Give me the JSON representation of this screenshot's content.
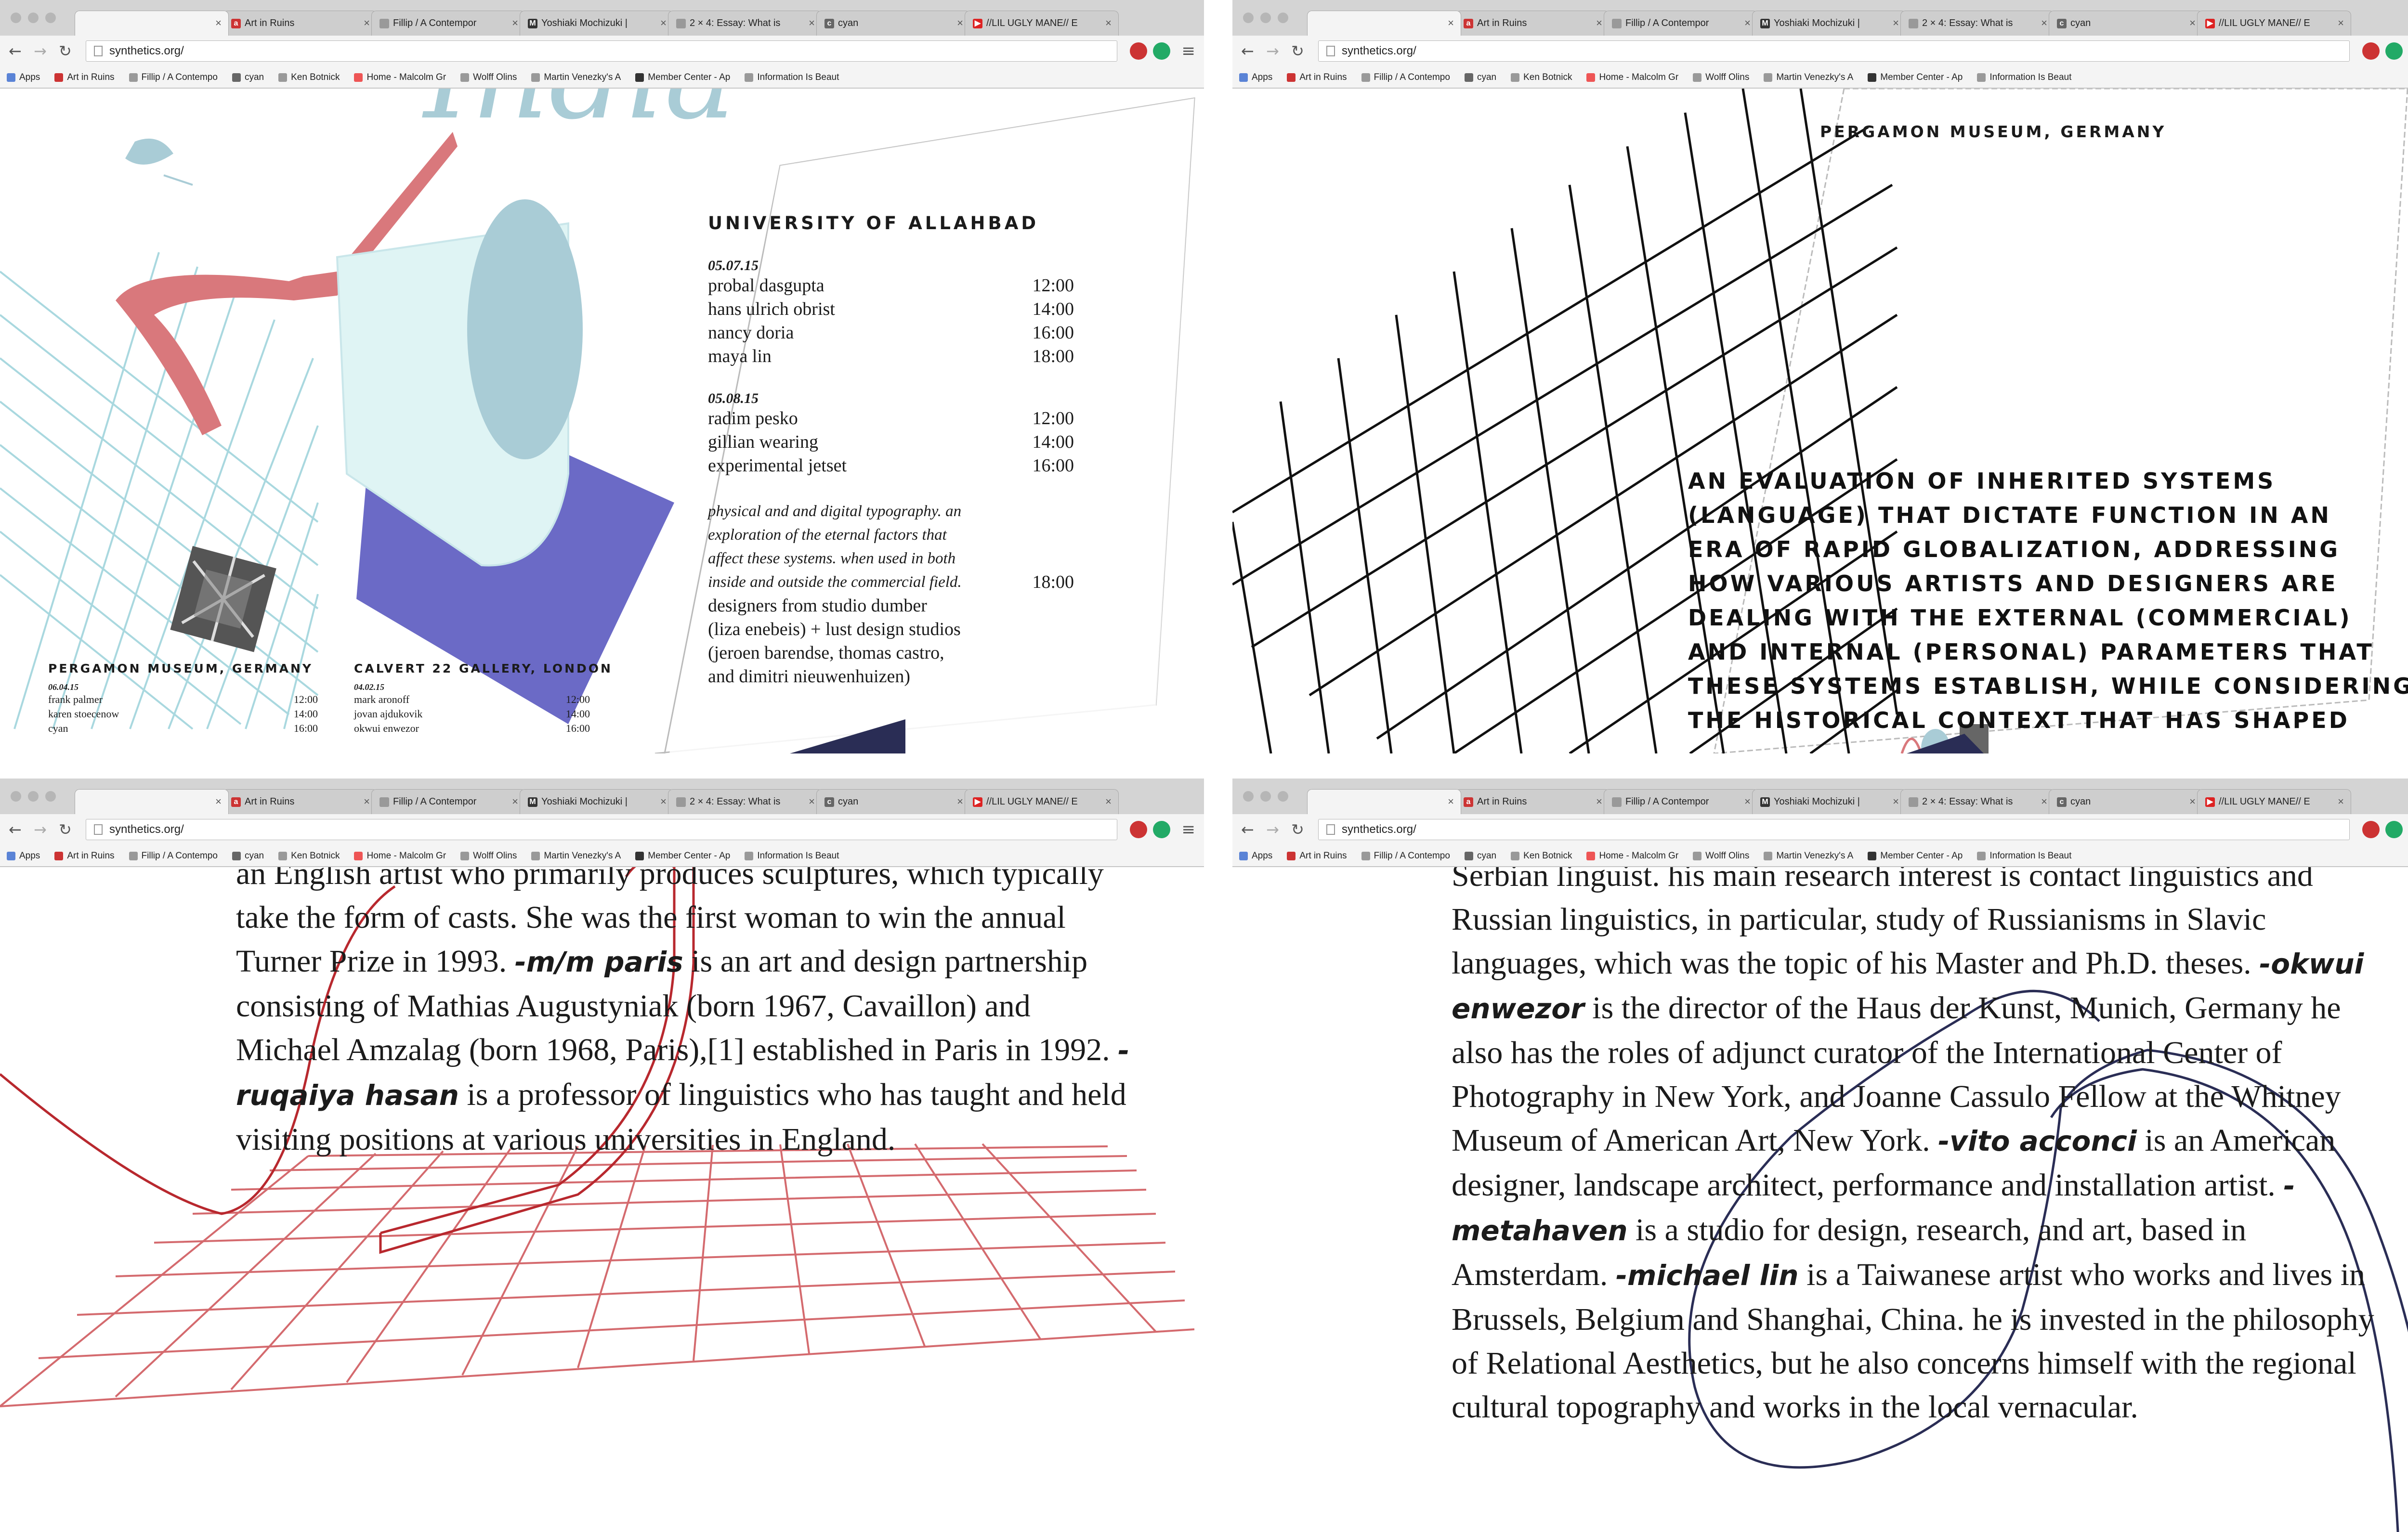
{
  "browser": {
    "url": "synthetics.org/",
    "tabs": [
      {
        "label": "Art in Ruins",
        "icon": "art-in-ruins-icon"
      },
      {
        "label": "Fillip / A Contempor",
        "icon": "page-icon"
      },
      {
        "label": "Yoshiaki Mochizuki |",
        "icon": "medium-m-icon"
      },
      {
        "label": "2 × 4: Essay: What is",
        "icon": "page-icon"
      },
      {
        "label": "cyan",
        "icon": "cyan-icon"
      },
      {
        "label": "//LIL UGLY MANE// E",
        "icon": "youtube-icon"
      }
    ],
    "bookmarks": [
      {
        "label": "Apps",
        "icon": "apps-grid-icon"
      },
      {
        "label": "Art in Ruins",
        "icon": "art-in-ruins-icon"
      },
      {
        "label": "Fillip / A Contempo",
        "icon": "page-icon"
      },
      {
        "label": "cyan",
        "icon": "cyan-icon"
      },
      {
        "label": "Ken Botnick",
        "icon": "page-icon"
      },
      {
        "label": "Home - Malcolm Gr",
        "icon": "page-icon"
      },
      {
        "label": "Wolff Olins",
        "icon": "page-icon"
      },
      {
        "label": "Martin Venezky's A",
        "icon": "page-icon"
      },
      {
        "label": "Member Center - Ap",
        "icon": "apple-icon"
      },
      {
        "label": "Information Is Beaut",
        "icon": "gear-icon"
      }
    ]
  },
  "q1": {
    "hero_word": "India",
    "venue_main": "UNIVERSITY OF ALLAHBAD",
    "day1": {
      "date": "05.07.15",
      "rows": [
        {
          "name": "probal dasgupta",
          "time": "12:00"
        },
        {
          "name": "hans ulrich obrist",
          "time": "14:00"
        },
        {
          "name": "nancy doria",
          "time": "16:00"
        },
        {
          "name": "maya lin",
          "time": "18:00"
        }
      ]
    },
    "day2": {
      "date": "05.08.15",
      "rows": [
        {
          "name": "radim pesko",
          "time": "12:00"
        },
        {
          "name": "gillian wearing",
          "time": "14:00"
        },
        {
          "name": "experimental jetset",
          "time": "16:00"
        }
      ]
    },
    "description": [
      "physical and and digital typography. an",
      "exploration of the eternal factors that",
      "affect these systems. when used in both",
      "inside and outside the commercial field."
    ],
    "description_time": "18:00",
    "designers": [
      "designers from studio dumber",
      "(liza enebeis) + lust design studios",
      "(jeroen barendse, thomas castro,",
      "and dimitri nieuwenhuizen)"
    ],
    "venue_left": {
      "title": "PERGAMON MUSEUM, GERMANY",
      "date": "06.04.15",
      "rows": [
        {
          "name": "frank palmer",
          "time": "12:00"
        },
        {
          "name": "karen stoecenow",
          "time": "14:00"
        },
        {
          "name": "cyan",
          "time": "16:00"
        }
      ]
    },
    "venue_mid": {
      "title": "CALVERT 22 GALLERY, LONDON",
      "date": "04.02.15",
      "rows": [
        {
          "name": "mark aronoff",
          "time": "12:00"
        },
        {
          "name": "jovan ajdukovik",
          "time": "14:00"
        },
        {
          "name": "okwui enwezor",
          "time": "16:00"
        }
      ]
    }
  },
  "q2": {
    "venue": "PERGAMON MUSEUM, GERMANY",
    "statement": [
      "AN EVALUATION OF INHERITED SYSTEMS",
      "(LANGUAGE) THAT DICTATE FUNCTION IN AN",
      "ERA OF RAPID GLOBALIZATION, ADDRESSING",
      "HOW VARIOUS ARTISTS AND DESIGNERS ARE",
      "DEALING WITH THE EXTERNAL (COMMERCIAL)",
      "AND INTERNAL (PERSONAL) PARAMETERS THAT",
      "THESE SYSTEMS ESTABLISH, WHILE CONSIDERING",
      "THE HISTORICAL CONTEXT THAT HAS SHAPED"
    ]
  },
  "q3": {
    "t1": "an English artist who primarily produces sculptures, which typically take the form of casts. She was the first woman to win the annual Turner Prize in 1993. ",
    "n1": "-m/m paris",
    "t2": " is an art and design partnership consisting of Mathias Augustyniak (born 1967, Cavaillon) and Michael Amzalag (born 1968, Paris),[1] established in Paris in 1992. ",
    "n2": "-ruqaiya hasan",
    "t3": " is a professor of linguistics who has taught and held visiting positions at various universities in England."
  },
  "q4": {
    "t1": "Serbian linguist. his main research interest is contact linguistics and Russian linguistics, in particular, study of Russianisms in Slavic languages, which was the topic of his Master and Ph.D. theses. ",
    "n1": "-okwui enwezor",
    "t2": " is the director of the Haus der Kunst, Munich, Germany he also has the roles of adjunct curator of the International Center of Photography in New York, and Joanne Cassulo Fellow at the Whitney Museum of American Art, New York. ",
    "n2": "-vito acconci",
    "t3": " is an American designer, landscape architect, performance and installation artist. ",
    "n3": "-metahaven",
    "t4": " is a studio for design, research, and art, based in Amsterdam. ",
    "n4": "-michael lin",
    "t5": " is a Taiwanese artist who works and lives in Brussels, Belgium and Shanghai, China. he is invested in the philosophy of Relational Aesthetics, but he also concerns himself with the regional cultural topography and works in the local vernacular."
  },
  "colors": {
    "cyan_grid": "#a9d8df",
    "red_ribbon": "#d9787c",
    "violet": "#6b6ac6",
    "navy": "#2a2d55",
    "dark_red": "#b8282e",
    "light_blue": "#a9ccd6"
  }
}
